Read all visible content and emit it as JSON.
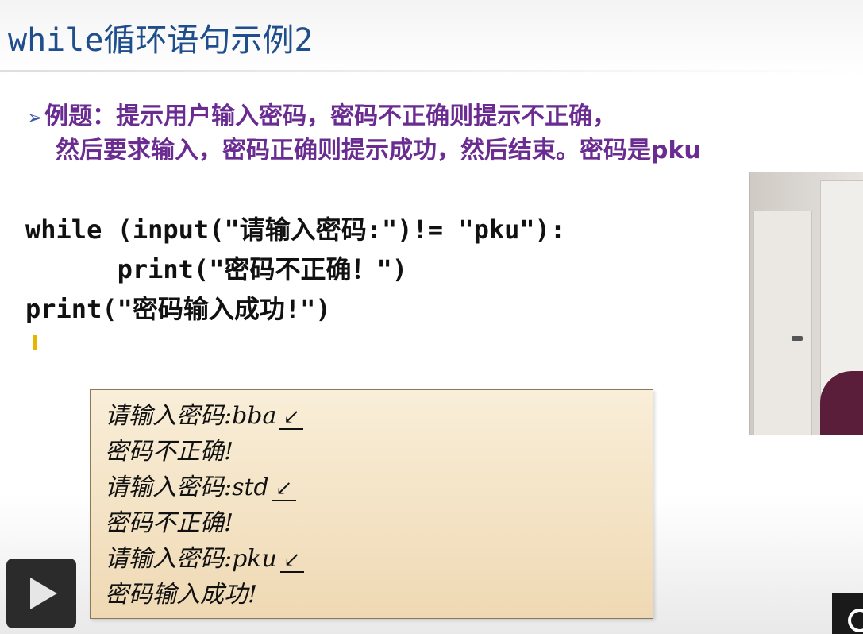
{
  "slide": {
    "title": "while循环语句示例2",
    "problem_marker": "➢",
    "problem_line1": "例题：提示用户输入密码，密码不正确则提示不正确，",
    "problem_line2": "然后要求输入，密码正确则提示成功，然后结束。密码是pku"
  },
  "code": {
    "line1": "while (input(\"请输入密码:\")!= \"pku\"):",
    "line2": "      print(\"密码不正确！\")",
    "line3": "print(\"密码输入成功!\")"
  },
  "output": {
    "lines": [
      {
        "prompt": "请输入密码:bba",
        "enter": "↙"
      },
      {
        "text": "密码不正确!"
      },
      {
        "prompt": "请输入密码:std",
        "enter": "↙"
      },
      {
        "text": "密码不正确!"
      },
      {
        "prompt": "请输入密码:pku",
        "enter": "↙"
      },
      {
        "text": "密码输入成功!"
      }
    ]
  },
  "controls": {
    "play_icon": "play-icon",
    "logo_icon": "player-logo-icon"
  }
}
